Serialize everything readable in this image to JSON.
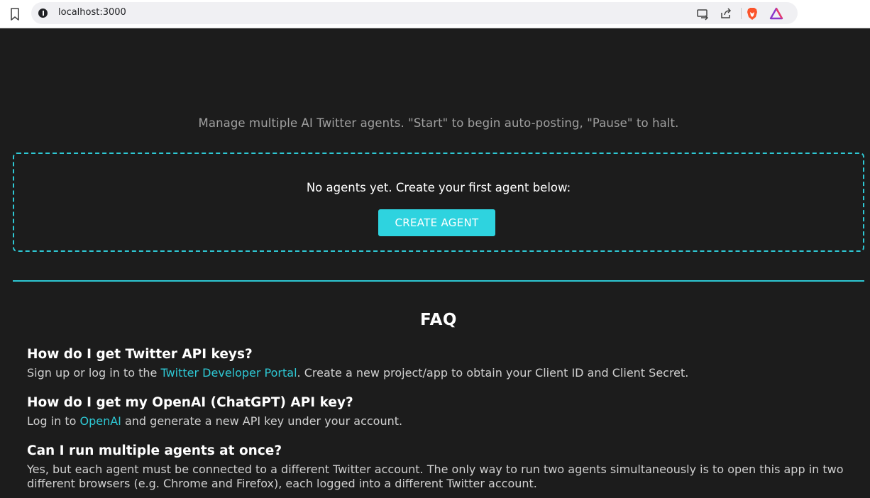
{
  "browser": {
    "url": "localhost:3000",
    "icons": [
      "bookmark-icon",
      "info-icon",
      "cast-icon",
      "share-icon",
      "brave-shield-icon",
      "brave-rewards-icon"
    ]
  },
  "header": {
    "subtitle": "Manage multiple AI Twitter agents. \"Start\" to begin auto-posting, \"Pause\" to halt."
  },
  "agents": {
    "empty_message": "No agents yet. Create your first agent below:",
    "create_button": "CREATE AGENT"
  },
  "faq": {
    "title": "FAQ",
    "items": [
      {
        "question": "How do I get Twitter API keys?",
        "answer_before": "Sign up or log in to the ",
        "link": "Twitter Developer Portal",
        "answer_after": ". Create a new project/app to obtain your Client ID and Client Secret."
      },
      {
        "question": "How do I get my OpenAI (ChatGPT) API key?",
        "answer_before": "Log in to ",
        "link": "OpenAI",
        "answer_after": " and generate a new API key under your account."
      },
      {
        "question": "Can I run multiple agents at once?",
        "answer_before": "Yes, but each agent must be connected to a different Twitter account. The only way to run two agents simultaneously is to open this app in two different browsers (e.g. Chrome and Firefox), each logged into a different Twitter account.",
        "link": "",
        "answer_after": ""
      }
    ]
  },
  "colors": {
    "background": "#1c1c1c",
    "accent": "#2ec8d4",
    "button": "#2ed3df"
  }
}
